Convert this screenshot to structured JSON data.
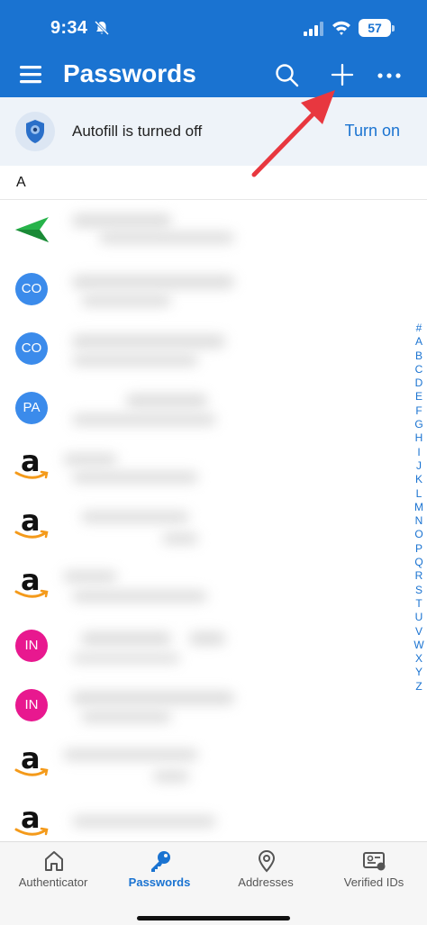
{
  "status_bar": {
    "time": "9:34",
    "battery": "57"
  },
  "header": {
    "title": "Passwords"
  },
  "banner": {
    "message": "Autofill is turned off",
    "action": "Turn on"
  },
  "section": {
    "letter": "A"
  },
  "entries": [
    {
      "avatar_type": "icon",
      "avatar_text": ""
    },
    {
      "avatar_type": "initials",
      "avatar_text": "CO",
      "color": "#3b8beb"
    },
    {
      "avatar_type": "initials",
      "avatar_text": "CO",
      "color": "#3b8beb"
    },
    {
      "avatar_type": "initials",
      "avatar_text": "PA",
      "color": "#3b8beb"
    },
    {
      "avatar_type": "amazon",
      "avatar_text": "a"
    },
    {
      "avatar_type": "amazon",
      "avatar_text": "a"
    },
    {
      "avatar_type": "amazon",
      "avatar_text": "a"
    },
    {
      "avatar_type": "initials",
      "avatar_text": "IN",
      "color": "#e8188f"
    },
    {
      "avatar_type": "initials",
      "avatar_text": "IN",
      "color": "#e8188f"
    },
    {
      "avatar_type": "amazon",
      "avatar_text": "a"
    },
    {
      "avatar_type": "amazon",
      "avatar_text": "a"
    }
  ],
  "alpha_index": [
    "#",
    "A",
    "B",
    "C",
    "D",
    "E",
    "F",
    "G",
    "H",
    "I",
    "J",
    "K",
    "L",
    "M",
    "N",
    "O",
    "P",
    "Q",
    "R",
    "S",
    "T",
    "U",
    "V",
    "W",
    "X",
    "Y",
    "Z"
  ],
  "bottom_nav": [
    {
      "label": "Authenticator",
      "icon": "home-icon",
      "active": false
    },
    {
      "label": "Passwords",
      "icon": "key-icon",
      "active": true
    },
    {
      "label": "Addresses",
      "icon": "location-pin-icon",
      "active": false
    },
    {
      "label": "Verified IDs",
      "icon": "id-card-icon",
      "active": false
    }
  ],
  "colors": {
    "brand": "#1a73d1",
    "annotation_arrow": "#e8373f"
  }
}
